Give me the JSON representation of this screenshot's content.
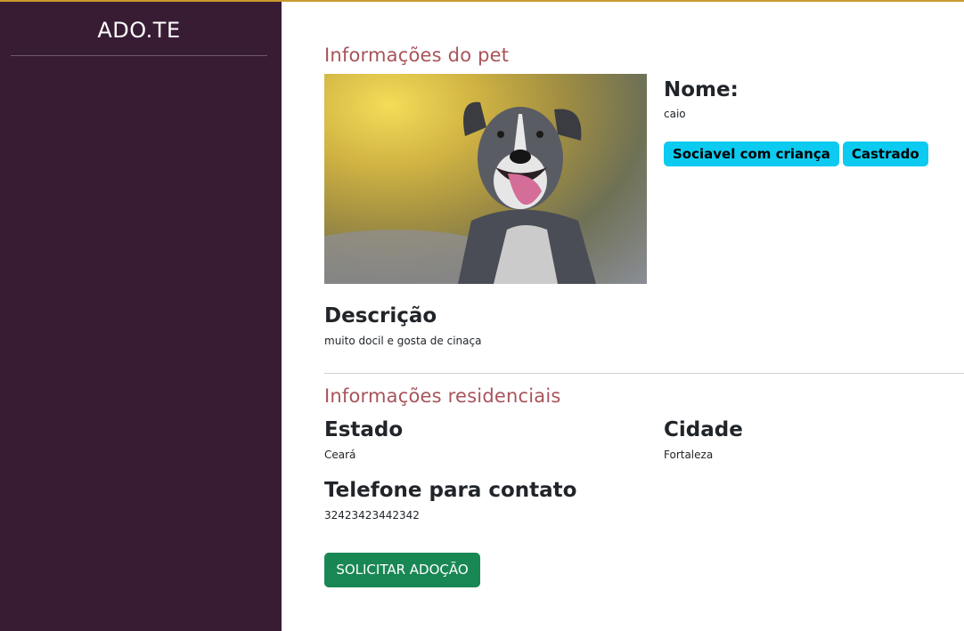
{
  "sidebar": {
    "brand": "ADO.TE"
  },
  "pet_section": {
    "title": "Informações do pet",
    "name_label": "Nome:",
    "name_value": "caio",
    "tags": [
      "Sociavel com criança",
      "Castrado"
    ],
    "description_label": "Descrição",
    "description_value": "muito docil e gosta de cinaça"
  },
  "residence_section": {
    "title": "Informações residenciais",
    "state_label": "Estado",
    "state_value": "Ceará",
    "city_label": "Cidade",
    "city_value": "Fortaleza",
    "phone_label": "Telefone para contato",
    "phone_value": "32423423442342"
  },
  "actions": {
    "request_adoption": "SOLICITAR ADOÇÃO"
  },
  "colors": {
    "sidebar_bg": "#381c33",
    "section_title": "#a8545a",
    "badge_bg": "#0dcaf0",
    "button_bg": "#198754"
  }
}
